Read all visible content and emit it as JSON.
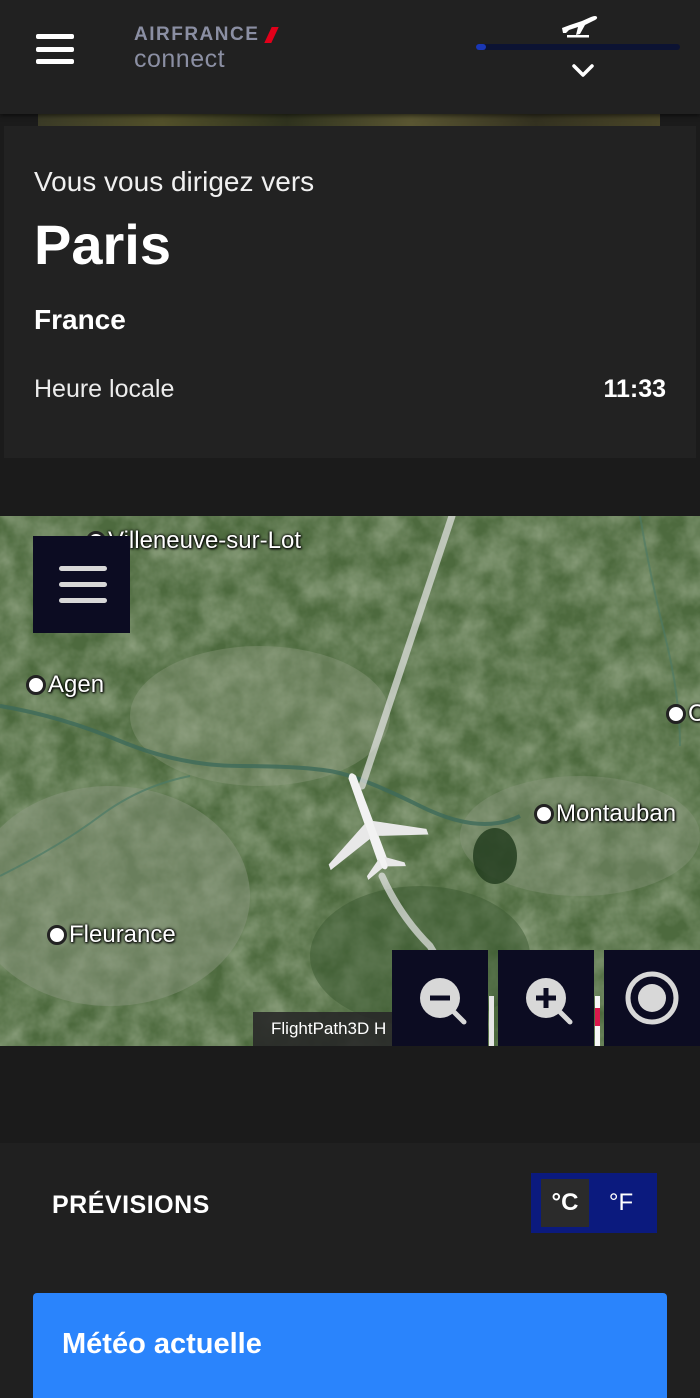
{
  "header": {
    "logo_brand": "AIRFRANCE",
    "logo_sub": "connect",
    "flight_progress_percent": 5,
    "icons": [
      "menu-icon",
      "plane-icon",
      "chevron-down-icon"
    ]
  },
  "destination": {
    "intro": "Vous vous dirigez vers",
    "city": "Paris",
    "country": "France",
    "local_time_label": "Heure locale",
    "local_time": "11:33"
  },
  "map": {
    "cities": [
      {
        "name": "Villeneuve-sur-Lot"
      },
      {
        "name": "Agen"
      },
      {
        "name": "Montauban"
      },
      {
        "name": "Fleurance"
      },
      {
        "name": "C"
      }
    ],
    "attribution": "FlightPath3D H",
    "controls": [
      "zoom-out-icon",
      "zoom-in-icon",
      "locate-icon"
    ],
    "colors": {
      "control_bg": "#0c0c22",
      "flight_track": "#e6e6e6"
    }
  },
  "forecast": {
    "title": "PRÉVISIONS",
    "unit_celsius": "°C",
    "unit_fahrenheit": "°F",
    "selected_unit": "°C",
    "current_weather_title": "Météo actuelle",
    "colors": {
      "card": "#2a84fc",
      "toggle": "#0b1a7e"
    }
  }
}
